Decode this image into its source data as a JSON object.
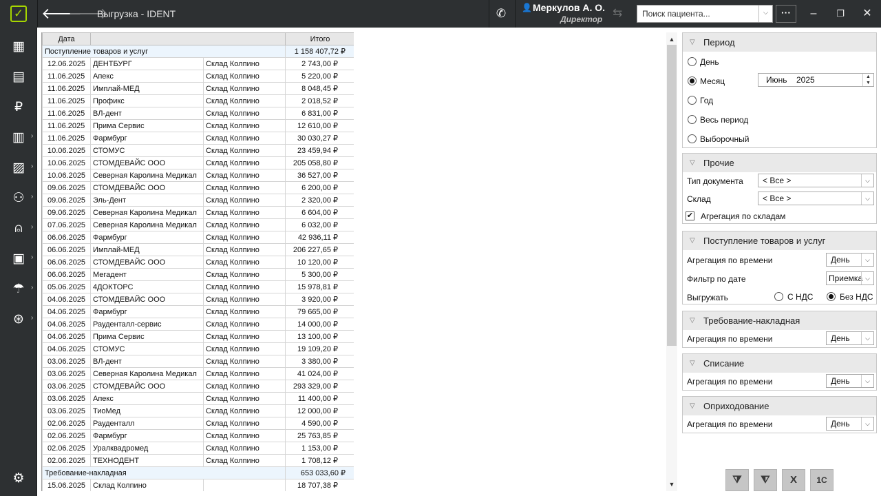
{
  "titlebar": {
    "title": "Выгрузка - IDENT",
    "user_name": "Меркулов А. О.",
    "user_role": "Директор",
    "search_placeholder": "Поиск пациента...",
    "more_label": "···"
  },
  "sidebar": {
    "items": [
      {
        "icon": "calendar-icon",
        "has_arrow": false
      },
      {
        "icon": "tasks-icon",
        "has_arrow": false
      },
      {
        "icon": "ruble-icon",
        "has_arrow": false
      },
      {
        "icon": "cash-register-icon",
        "has_arrow": true
      },
      {
        "icon": "reports-icon",
        "has_arrow": true
      },
      {
        "icon": "staff-icon",
        "has_arrow": true
      },
      {
        "icon": "tooth-icon",
        "has_arrow": true
      },
      {
        "icon": "warehouse-icon",
        "has_arrow": true
      },
      {
        "icon": "insurance-umbrella-icon",
        "has_arrow": true
      },
      {
        "icon": "payments-icon",
        "has_arrow": true
      },
      {
        "icon": "settings-gear-icon",
        "has_arrow": true
      }
    ]
  },
  "grid": {
    "columns": [
      "Дата",
      "Итого"
    ],
    "groups": [
      {
        "name": "Поступление товаров и услуг",
        "total": "1 158 407,72 ₽",
        "rows": [
          [
            "12.06.2025",
            "ДЕНТБУРГ",
            "Склад Колпино",
            "2 743,00 ₽"
          ],
          [
            "11.06.2025",
            "Апекс",
            "Склад Колпино",
            "5 220,00 ₽"
          ],
          [
            "11.06.2025",
            "Имплай-МЕД",
            "Склад Колпино",
            "8 048,45 ₽"
          ],
          [
            "11.06.2025",
            "Профикс",
            "Склад Колпино",
            "2 018,52 ₽"
          ],
          [
            "11.06.2025",
            "ВЛ-дент",
            "Склад Колпино",
            "6 831,00 ₽"
          ],
          [
            "11.06.2025",
            "Прима Сервис",
            "Склад Колпино",
            "12 610,00 ₽"
          ],
          [
            "11.06.2025",
            "Фармбург",
            "Склад Колпино",
            "30 030,27 ₽"
          ],
          [
            "10.06.2025",
            "СТОМУС",
            "Склад Колпино",
            "23 459,94 ₽"
          ],
          [
            "10.06.2025",
            "СТОМДЕВАЙС ООО",
            "Склад Колпино",
            "205 058,80 ₽"
          ],
          [
            "10.06.2025",
            "Северная Каролина Медикал",
            "Склад Колпино",
            "36 527,00 ₽"
          ],
          [
            "09.06.2025",
            "СТОМДЕВАЙС ООО",
            "Склад Колпино",
            "6 200,00 ₽"
          ],
          [
            "09.06.2025",
            "Эль-Дент",
            "Склад Колпино",
            "2 320,00 ₽"
          ],
          [
            "09.06.2025",
            "Северная Каролина Медикал",
            "Склад Колпино",
            "6 604,00 ₽"
          ],
          [
            "07.06.2025",
            "Северная Каролина Медикал",
            "Склад Колпино",
            "6 032,00 ₽"
          ],
          [
            "06.06.2025",
            "Фармбург",
            "Склад Колпино",
            "42 936,11 ₽"
          ],
          [
            "06.06.2025",
            "Имплай-МЕД",
            "Склад Колпино",
            "206 227,65 ₽"
          ],
          [
            "06.06.2025",
            "СТОМДЕВАЙС ООО",
            "Склад Колпино",
            "10 120,00 ₽"
          ],
          [
            "06.06.2025",
            "Мегадент",
            "Склад Колпино",
            "5 300,00 ₽"
          ],
          [
            "05.06.2025",
            "4ДОКТОРС",
            "Склад Колпино",
            "15 978,81 ₽"
          ],
          [
            "04.06.2025",
            "СТОМДЕВАЙС ООО",
            "Склад Колпино",
            "3 920,00 ₽"
          ],
          [
            "04.06.2025",
            "Фармбург",
            "Склад Колпино",
            "79 665,00 ₽"
          ],
          [
            "04.06.2025",
            "Рауденталл-сервис",
            "Склад Колпино",
            "14 000,00 ₽"
          ],
          [
            "04.06.2025",
            "Прима Сервис",
            "Склад Колпино",
            "13 100,00 ₽"
          ],
          [
            "04.06.2025",
            "СТОМУС",
            "Склад Колпино",
            "19 109,20 ₽"
          ],
          [
            "03.06.2025",
            "ВЛ-дент",
            "Склад Колпино",
            "3 380,00 ₽"
          ],
          [
            "03.06.2025",
            "Северная Каролина Медикал",
            "Склад Колпино",
            "41 024,00 ₽"
          ],
          [
            "03.06.2025",
            "СТОМДЕВАЙС ООО",
            "Склад Колпино",
            "293 329,00 ₽"
          ],
          [
            "03.06.2025",
            "Апекс",
            "Склад Колпино",
            "11 400,00 ₽"
          ],
          [
            "03.06.2025",
            "ТиоМед",
            "Склад Колпино",
            "12 000,00 ₽"
          ],
          [
            "02.06.2025",
            "Рауденталл",
            "Склад Колпино",
            "4 590,00 ₽"
          ],
          [
            "02.06.2025",
            "Фармбург",
            "Склад Колпино",
            "25 763,85 ₽"
          ],
          [
            "02.06.2025",
            "Уралквадромед",
            "Склад Колпино",
            "1 153,00 ₽"
          ],
          [
            "02.06.2025",
            "ТЕХНОДЕНТ",
            "Склад Колпино",
            "1 708,12 ₽"
          ]
        ]
      },
      {
        "name": "Требование-накладная",
        "total": "653 033,60 ₽",
        "rows": [
          [
            "15.06.2025",
            "Склад Колпино",
            "",
            "18 707,38 ₽"
          ]
        ]
      }
    ]
  },
  "panel": {
    "period": {
      "title": "Период",
      "options": [
        "День",
        "Месяц",
        "Год",
        "Весь период",
        "Выборочный"
      ],
      "selected": 1,
      "month": "Июнь",
      "year": "2025"
    },
    "other": {
      "title": "Прочие",
      "doc_type_label": "Тип документа",
      "doc_type_value": "< Все >",
      "warehouse_label": "Склад",
      "warehouse_value": "< Все >",
      "aggregate_label": "Агрегация по складам",
      "aggregate_checked": true
    },
    "receipts": {
      "title": "Поступление товаров и услуг",
      "time_agg_label": "Агрегация по времени",
      "time_agg_value": "День",
      "date_filter_label": "Фильтр по дате",
      "date_filter_value": "Приемка",
      "export_label": "Выгружать",
      "vat_with": "С НДС",
      "vat_without": "Без НДС",
      "vat_selected": "without"
    },
    "requisition": {
      "title": "Требование-накладная",
      "time_agg_label": "Агрегация по времени",
      "time_agg_value": "День"
    },
    "writeoff": {
      "title": "Списание",
      "time_agg_label": "Агрегация по времени",
      "time_agg_value": "День"
    },
    "posting": {
      "title": "Оприходование",
      "time_agg_label": "Агрегация по времени",
      "time_agg_value": "День"
    }
  },
  "footer_buttons": [
    "add-filter-icon",
    "remove-filter-icon",
    "excel-export-icon",
    "1c-export-icon"
  ]
}
